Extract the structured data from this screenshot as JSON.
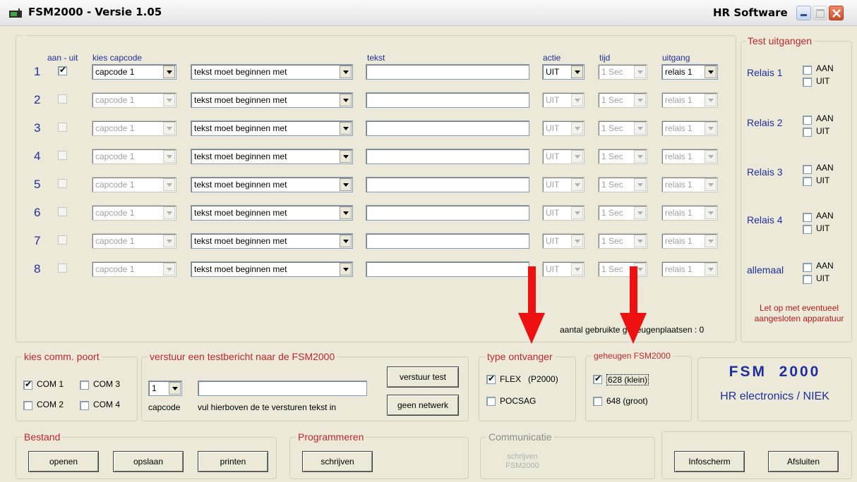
{
  "window": {
    "title": "FSM2000 - Versie 1.05",
    "company": "HR Software"
  },
  "headers": {
    "aan_uit": "aan - uit",
    "kies_capcode": "kies capcode",
    "tekst": "tekst",
    "actie": "actie",
    "tijd": "tijd",
    "uitgang": "uitgang"
  },
  "rows": [
    {
      "num": "1",
      "checked": true,
      "capcode": "capcode 1",
      "filter": "tekst moet beginnen met",
      "text": "",
      "actie": "UIT",
      "tijd": "1 Sec",
      "uitgang": "relais 1",
      "enabled": true
    },
    {
      "num": "2",
      "checked": false,
      "capcode": "capcode 1",
      "filter": "tekst moet beginnen met",
      "text": "",
      "actie": "UIT",
      "tijd": "1 Sec",
      "uitgang": "relais 1",
      "enabled": false
    },
    {
      "num": "3",
      "checked": false,
      "capcode": "capcode 1",
      "filter": "tekst moet beginnen met",
      "text": "",
      "actie": "UIT",
      "tijd": "1 Sec",
      "uitgang": "relais 1",
      "enabled": false
    },
    {
      "num": "4",
      "checked": false,
      "capcode": "capcode 1",
      "filter": "tekst moet beginnen met",
      "text": "",
      "actie": "UIT",
      "tijd": "1 Sec",
      "uitgang": "relais 1",
      "enabled": false
    },
    {
      "num": "5",
      "checked": false,
      "capcode": "capcode 1",
      "filter": "tekst moet beginnen met",
      "text": "",
      "actie": "UIT",
      "tijd": "1 Sec",
      "uitgang": "relais 1",
      "enabled": false
    },
    {
      "num": "6",
      "checked": false,
      "capcode": "capcode 1",
      "filter": "tekst moet beginnen met",
      "text": "",
      "actie": "UIT",
      "tijd": "1 Sec",
      "uitgang": "relais 1",
      "enabled": false
    },
    {
      "num": "7",
      "checked": false,
      "capcode": "capcode 1",
      "filter": "tekst moet beginnen met",
      "text": "",
      "actie": "UIT",
      "tijd": "1 Sec",
      "uitgang": "relais 1",
      "enabled": false
    },
    {
      "num": "8",
      "checked": false,
      "capcode": "capcode 1",
      "filter": "tekst moet beginnen met",
      "text": "",
      "actie": "UIT",
      "tijd": "1 Sec",
      "uitgang": "relais 1",
      "enabled": false
    }
  ],
  "geheugen_status": "aantal gebruikte geheugenplaatsen : 0",
  "test_uitgangen": {
    "title": "Test uitgangen",
    "aan": "AAN",
    "uit": "UIT",
    "items": [
      "Relais 1",
      "Relais 2",
      "Relais 3",
      "Relais 4",
      "allemaal"
    ],
    "warning": "Let op met eventueel aangesloten apparatuur"
  },
  "comm": {
    "title": "kies comm. poort",
    "ports": [
      {
        "label": "COM 1",
        "checked": true
      },
      {
        "label": "COM 3",
        "checked": false
      },
      {
        "label": "COM 2",
        "checked": false
      },
      {
        "label": "COM 4",
        "checked": false
      }
    ]
  },
  "testmsg": {
    "title": "verstuur een testbericht naar de FSM2000",
    "capcode_value": "1",
    "capcode_label": "capcode",
    "hint": "vul hierboven de te versturen tekst in",
    "send_label": "verstuur test",
    "network_label": "geen netwerk"
  },
  "ontvanger": {
    "title": "type ontvanger",
    "flex": "FLEX   (P2000)",
    "flex_checked": true,
    "pocsag": "POCSAG",
    "pocsag_checked": false
  },
  "geheugen": {
    "title": "geheugen FSM2000",
    "klein": "628 (klein)",
    "klein_checked": true,
    "groot": "648 (groot)",
    "groot_checked": false
  },
  "brand": {
    "name": "FSM  2000",
    "sub": "HR electronics / NIEK"
  },
  "bestand": {
    "title": "Bestand",
    "open": "openen",
    "save": "opslaan",
    "print": "printen"
  },
  "programmeren": {
    "title": "Programmeren",
    "write": "schrijven"
  },
  "communicatie": {
    "title": "Communicatie",
    "line1": "schrijven",
    "line2": "FSM2000"
  },
  "bottom": {
    "info": "Infoscherm",
    "close": "Afsluiten"
  },
  "colors": {
    "accent_blue": "#1e2fa0",
    "legend_red": "#c0272d",
    "annotation_arrow": "#ee1111"
  }
}
